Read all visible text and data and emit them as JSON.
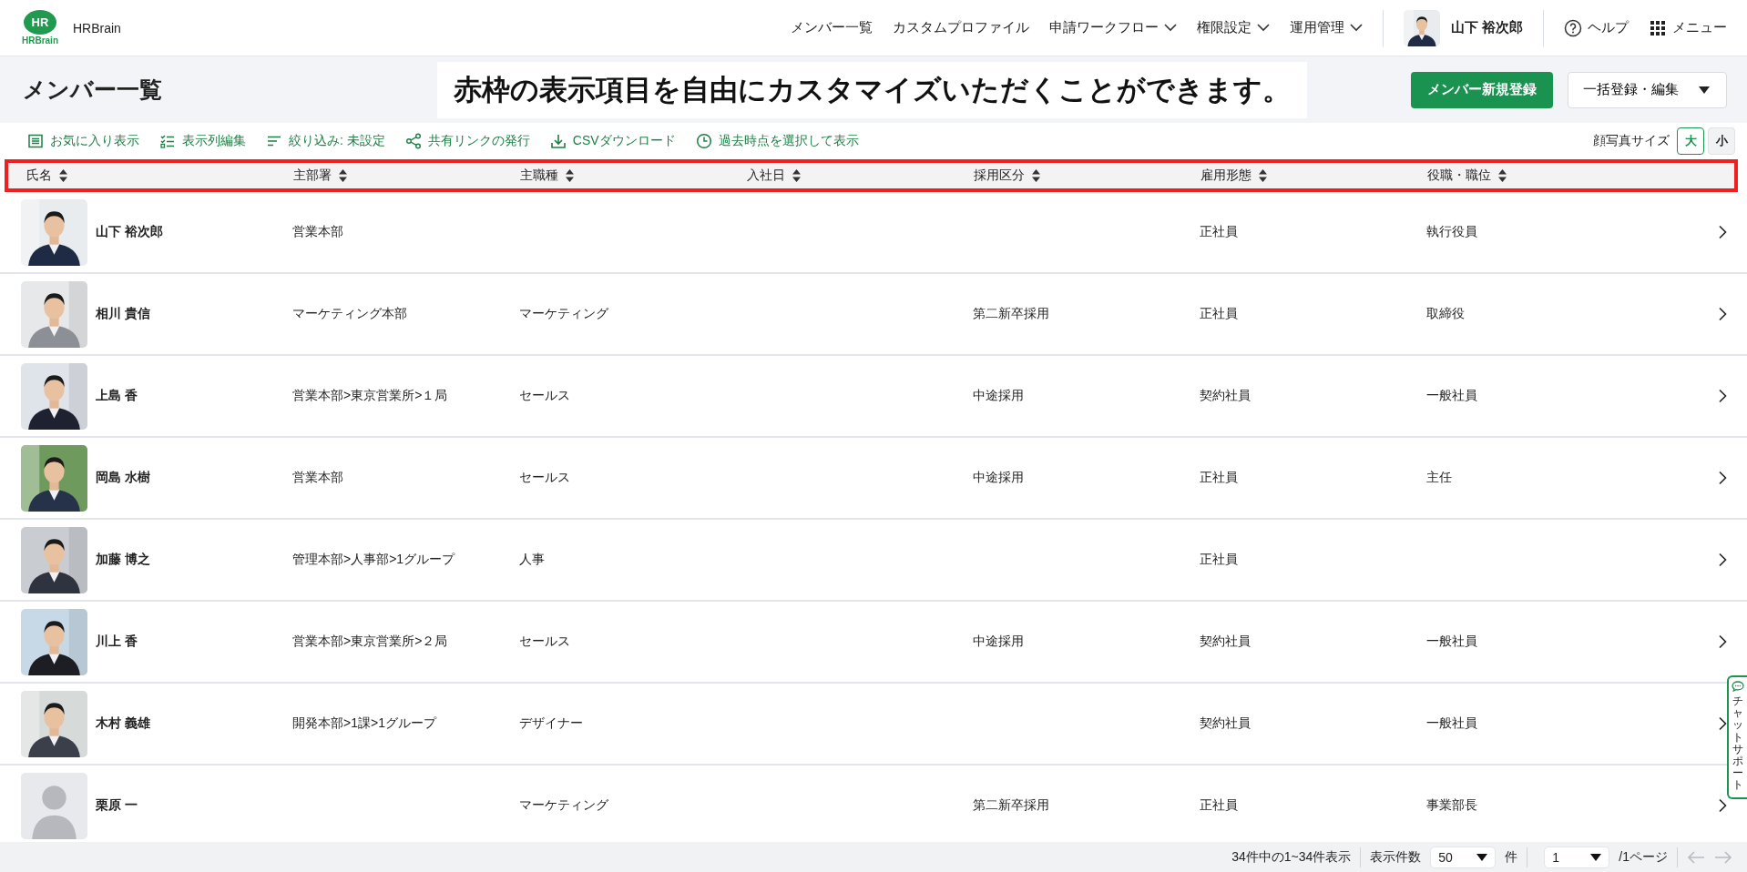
{
  "header": {
    "logo_mark": "HR",
    "logo_word": "HRBrain",
    "app_name": "HRBrain",
    "nav": [
      {
        "label": "メンバー一覧",
        "has_menu": false
      },
      {
        "label": "カスタムプロファイル",
        "has_menu": false
      },
      {
        "label": "申請ワークフロー",
        "has_menu": true
      },
      {
        "label": "権限設定",
        "has_menu": true
      },
      {
        "label": "運用管理",
        "has_menu": true
      }
    ],
    "user": {
      "name": "山下 裕次郎",
      "avatar": {
        "kind": "picture"
      }
    },
    "help": "ヘルプ",
    "menu": "メニュー"
  },
  "page": {
    "title": "メンバー一覧",
    "callout": "赤枠の表示項目を自由にカスタマイズいただくことができます。",
    "primary_button": "メンバー新規登録",
    "secondary_button": "一括登録・編集"
  },
  "toolbar": {
    "actions": [
      "お気に入り表示",
      "表示列編集",
      "絞り込み: 未設定",
      "共有リンクの発行",
      "CSVダウンロード",
      "過去時点を選択して表示"
    ],
    "photo_size_label": "顔写真サイズ",
    "photo_sizes": [
      {
        "label": "大",
        "selected": true
      },
      {
        "label": "小",
        "selected": false
      }
    ]
  },
  "table": {
    "highlighted": true,
    "columns": [
      "氏名",
      "主部署",
      "主職種",
      "入社日",
      "採用区分",
      "雇用形態",
      "役職・職位"
    ],
    "rows": [
      {
        "photo": {
          "kind": "picture"
        },
        "cells": [
          "山下 裕次郎",
          "営業本部",
          "",
          "",
          "",
          "正社員",
          "執行役員"
        ]
      },
      {
        "photo": {
          "kind": "picture"
        },
        "cells": [
          "相川 貴信",
          "マーケティング本部",
          "マーケティング",
          "",
          "第二新卒採用",
          "正社員",
          "取締役"
        ]
      },
      {
        "photo": {
          "kind": "picture"
        },
        "cells": [
          "上島 香",
          "営業本部>東京営業所>１局",
          "セールス",
          "",
          "中途採用",
          "契約社員",
          "一般社員"
        ]
      },
      {
        "photo": {
          "kind": "picture"
        },
        "cells": [
          "岡島 水樹",
          "営業本部",
          "セールス",
          "",
          "中途採用",
          "正社員",
          "主任"
        ]
      },
      {
        "photo": {
          "kind": "picture"
        },
        "cells": [
          "加藤 博之",
          "管理本部>人事部>1グループ",
          "人事",
          "",
          "",
          "正社員",
          ""
        ]
      },
      {
        "photo": {
          "kind": "picture"
        },
        "cells": [
          "川上 香",
          "営業本部>東京営業所>２局",
          "セールス",
          "",
          "中途採用",
          "契約社員",
          "一般社員"
        ]
      },
      {
        "photo": {
          "kind": "picture"
        },
        "cells": [
          "木村 義雄",
          "開発本部>1課>1グループ",
          "デザイナー",
          "",
          "",
          "契約社員",
          "一般社員"
        ]
      },
      {
        "photo": {
          "kind": "default"
        },
        "cells": [
          "栗原 一",
          "",
          "マーケティング",
          "",
          "第二新卒採用",
          "正社員",
          "事業部長"
        ]
      }
    ]
  },
  "footer": {
    "summary": "34件中の1~34件表示",
    "per_page_label": "表示件数",
    "per_page": "50",
    "per_page_unit": "件",
    "page": "1",
    "page_total": "/1ページ",
    "prev": {
      "disabled": true
    },
    "next": {
      "disabled": true
    }
  },
  "chat_support": "チャットサポート"
}
